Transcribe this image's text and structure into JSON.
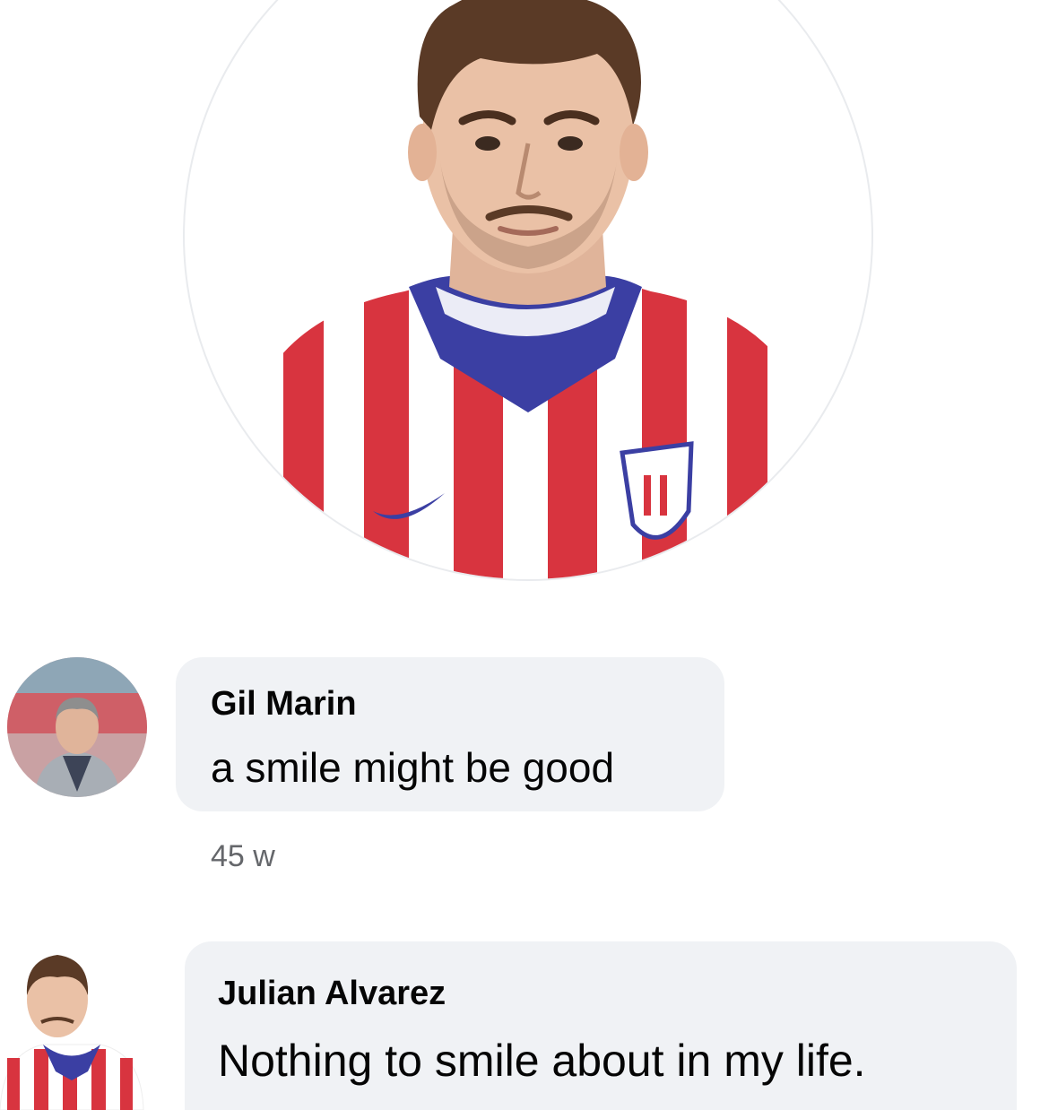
{
  "profile": {
    "photo_icon": "profile-photo-player-striped-jersey"
  },
  "comments": [
    {
      "author": "Gil Marin",
      "text": "a smile might be good",
      "time": "45 w"
    },
    {
      "author": "Julian Alvarez",
      "text": "Nothing to smile about in my life."
    }
  ],
  "colors": {
    "bubble": "#f0f2f5",
    "jersey_red": "#d8343f",
    "jersey_blue": "#3b3fa3",
    "timestamp": "#65676b"
  }
}
